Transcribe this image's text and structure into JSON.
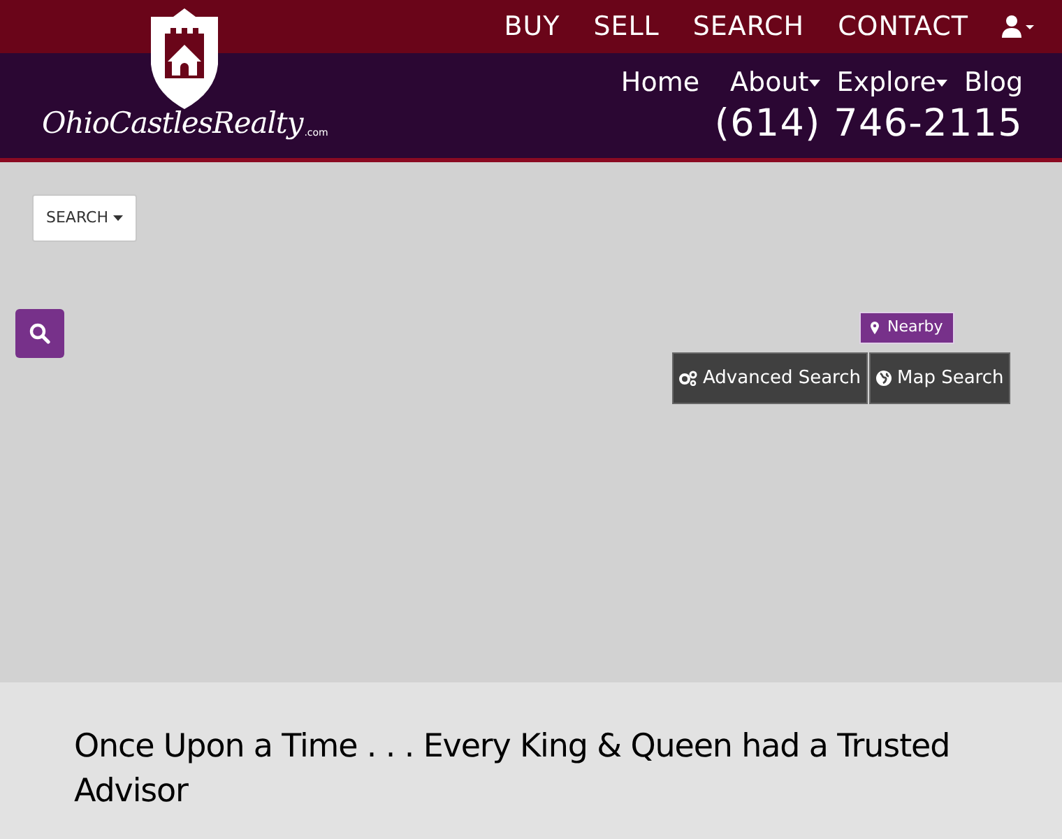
{
  "logo": {
    "name": "OhioCastlesRealty",
    "suffix": ".com"
  },
  "top_nav": [
    {
      "label": "BUY"
    },
    {
      "label": "SELL"
    },
    {
      "label": "SEARCH"
    },
    {
      "label": "CONTACT"
    }
  ],
  "main_nav": [
    {
      "label": "Home",
      "dropdown": false
    },
    {
      "label": "About",
      "dropdown": true
    },
    {
      "label": "Explore",
      "dropdown": true
    },
    {
      "label": "Blog",
      "dropdown": false
    }
  ],
  "phone": "(614) 746-2115",
  "search_dropdown": "SEARCH",
  "nearby_button": "Nearby",
  "search_buttons": [
    {
      "label": "Advanced Search",
      "kind": "gears"
    },
    {
      "label": "Map Search",
      "kind": "globe"
    }
  ],
  "heading": "Once Upon a Time . . . Every King & Queen had a Trusted Advisor"
}
